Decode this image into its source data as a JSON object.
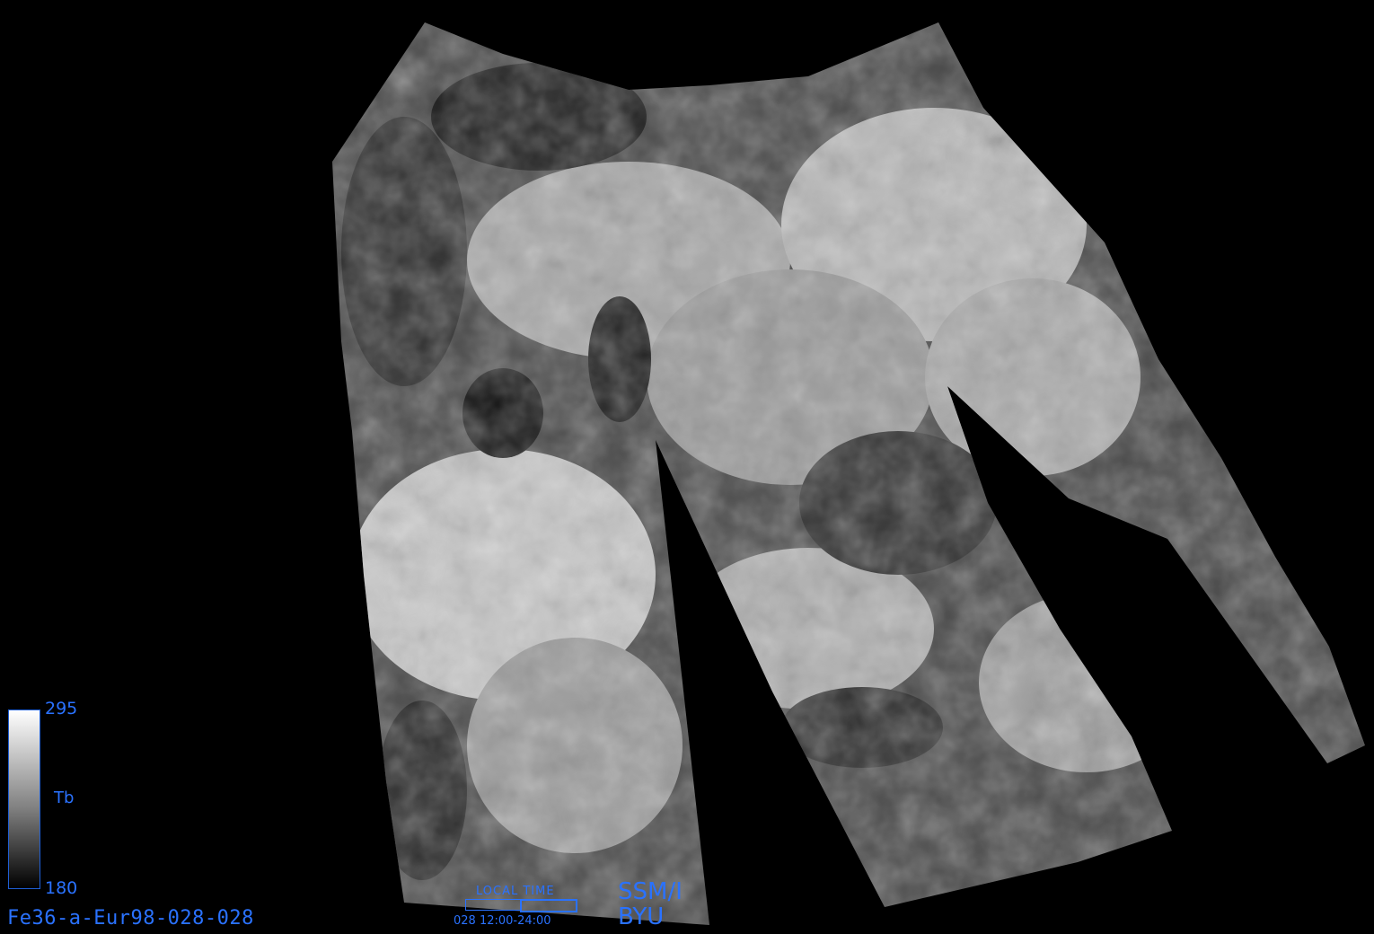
{
  "legend": {
    "max": "295",
    "variable": "Tb",
    "min": "180"
  },
  "product_id": "Fe36-a-Eur98-028-028",
  "local_time": {
    "title": "LOCAL TIME",
    "range": "028 12:00-24:00"
  },
  "sensor": "SSM/I",
  "organization": "BYU",
  "colors": {
    "label": "#2a72ff",
    "background": "#000000"
  }
}
